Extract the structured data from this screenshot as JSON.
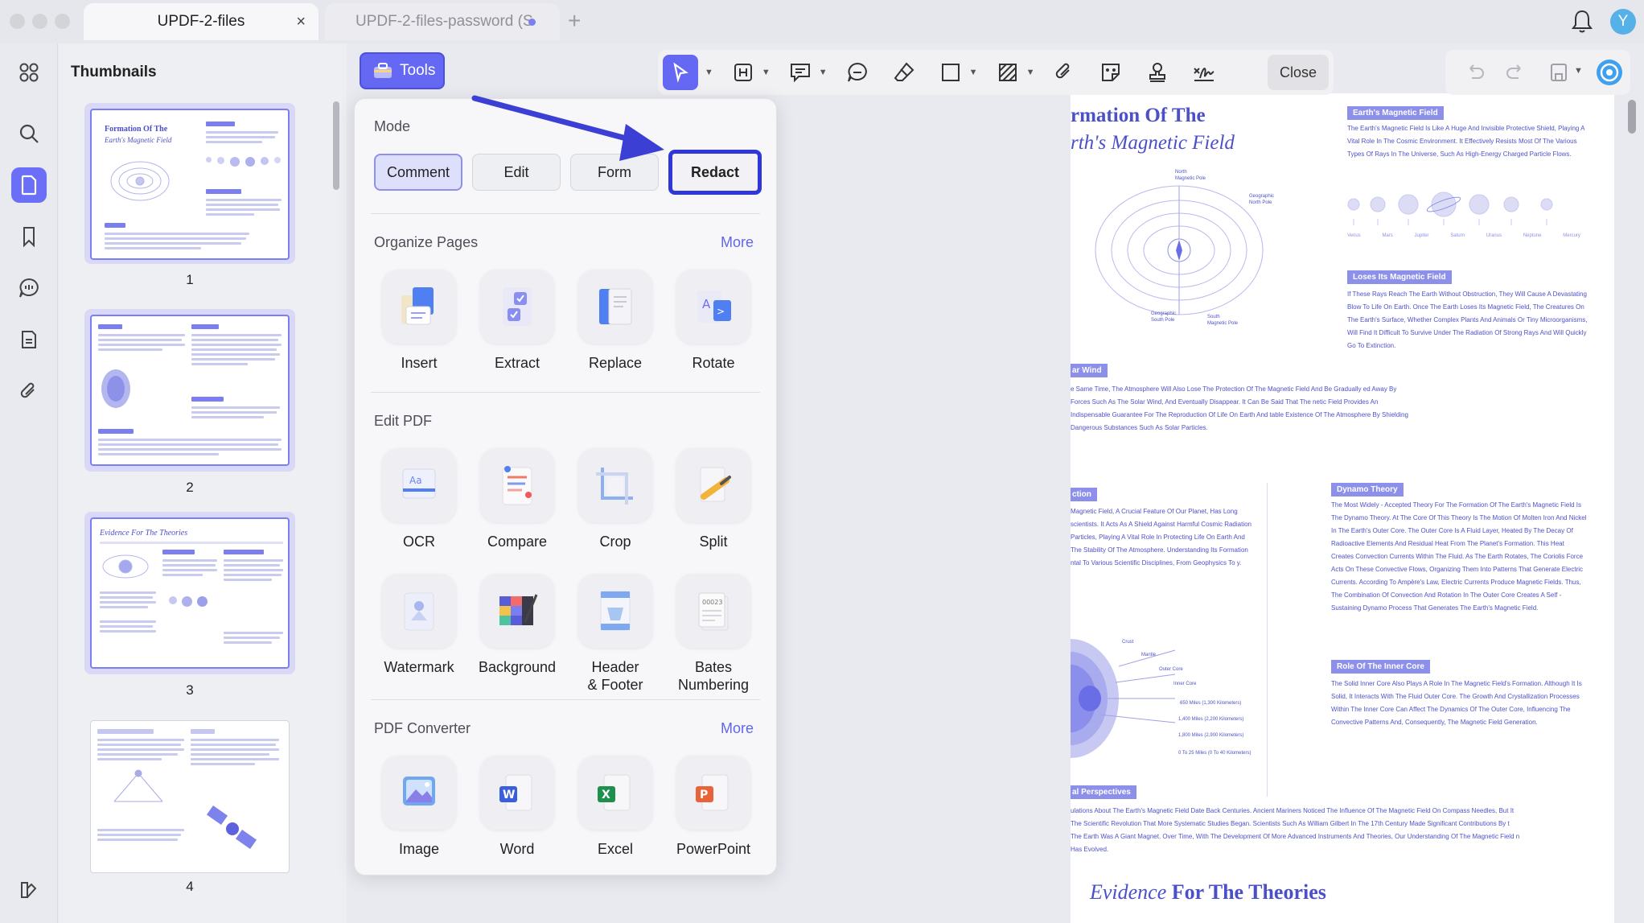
{
  "tabs": [
    {
      "title": "UPDF-2-files",
      "close": "×"
    },
    {
      "title": "UPDF-2-files-password (S"
    }
  ],
  "new_tab": "+",
  "avatar": "Y",
  "thumbnails": {
    "heading": "Thumbnails",
    "pages": [
      {
        "num": "1",
        "title": "Formation Of The",
        "title2": "Earth's Magnetic Field"
      },
      {
        "num": "2"
      },
      {
        "num": "3",
        "title": "Evidence For The Theories"
      },
      {
        "num": "4"
      }
    ]
  },
  "toolbar": {
    "tools_label": "Tools",
    "close_label": "Close"
  },
  "popup": {
    "mode": {
      "title": "Mode",
      "buttons": [
        "Comment",
        "Edit",
        "Form",
        "Redact"
      ],
      "selected": "Comment"
    },
    "organize": {
      "title": "Organize Pages",
      "more": "More",
      "items": [
        "Insert",
        "Extract",
        "Replace",
        "Rotate"
      ]
    },
    "edit_pdf": {
      "title": "Edit PDF",
      "items": [
        "OCR",
        "Compare",
        "Crop",
        "Split",
        "Watermark",
        "Background",
        "Header\n& Footer",
        "Bates\nNumbering"
      ]
    },
    "converter": {
      "title": "PDF Converter",
      "more": "More",
      "items": [
        "Image",
        "Word",
        "Excel",
        "PowerPoint"
      ]
    }
  },
  "document": {
    "page1": {
      "title_line1": "rmation Of The",
      "title_line2": "rth's Magnetic Field",
      "label1": "Earth's Magnetic Field",
      "para1": "The Earth's Magnetic Field Is Like A Huge And Invisible Protective Shield, Playing A Vital Role In The Cosmic Environment. It Effectively Resists Most Of The Various Types Of Rays In The Universe, Such As High-Energy Charged Particle Flows.",
      "planet_labels": [
        "Venus",
        "Mars",
        "Jupiter",
        "Saturn",
        "Uranus",
        "Neptune",
        "Mercury"
      ],
      "label2": "Loses Its Magnetic Field",
      "para2": "If These Rays Reach The Earth Without Obstruction, They Will Cause A Devastating Blow To Life On Earth. Once The Earth Loses Its Magnetic Field, The Creatures On The Earth's Surface, Whether Complex Plants And Animals Or Tiny Microorganisms, Will Find It Difficult To Survive Under The Radiation Of Strong Rays And Will Quickly Go To Extinction.",
      "label3": "ar Wind",
      "para3": "e Same Time, The Atmosphere Will Also Lose The Protection Of The Magnetic Field And Be Gradually ed Away By Forces Such As The Solar Wind, And Eventually Disappear. It Can Be Said That The netic Field Provides An Indispensable Guarantee For The Reproduction Of Life On Earth And table Existence Of The Atmosphere By Shielding Dangerous Substances Such As Solar Particles.",
      "diagram_labels": [
        "North Magnetic Pole",
        "Geographic North Pole",
        "Geographic South Pole",
        "South Magnetic Pole"
      ]
    },
    "page2": {
      "label_left": "ction",
      "para_left": "Magnetic Field, A Crucial Feature Of Our Planet, Has Long scientists. It Acts As A Shield Against Harmful Cosmic Radiation Particles, Playing A Vital Role In Protecting Life On Earth And The Stability Of The Atmosphere. Understanding Its Formation ntal To Various Scientific Disciplines, From Geophysics To y.",
      "label_dynamo": "Dynamo Theory",
      "para_dynamo": "The Most Widely - Accepted Theory For The Formation Of The Earth's Magnetic Field Is The Dynamo Theory. At The Core Of This Theory Is The Motion Of Molten Iron And Nickel In The Earth's Outer Core. The Outer Core Is A Fluid Layer, Heated By The Decay Of Radioactive Elements And Residual Heat From The Planet's Formation. This Heat Creates Convection Currents Within The Fluid. As The Earth Rotates, The Coriolis Force Acts On These Convective Flows, Organizing Them Into Patterns That Generate Electric Currents. According To Ampère's Law, Electric Currents Produce Magnetic Fields. Thus, The Combination Of Convection And Rotation In The Outer Core Creates A Self - Sustaining Dynamo Process That Generates The Earth's Magnetic Field.",
      "label_inner": "Role Of The Inner Core",
      "para_inner": "The Solid Inner Core Also Plays A Role In The Magnetic Field's Formation. Although It Is Solid, It Interacts With The Fluid Outer Core. The Growth And Crystallization Processes Within The Inner Core Can Affect The Dynamics Of The Outer Core, Influencing The Convective Patterns And, Consequently, The Magnetic Field Generation.",
      "layer_labels": [
        "Crust",
        "Mantle",
        "Outer Core",
        "Inner Core"
      ],
      "depth_labels": [
        "650 Miles (1,300 Kilometers)",
        "1,400 Miles (2,200 Kilometers)",
        "1,800 Miles (2,900 Kilometers)",
        "0 To 25 Miles (0 To 40 Kilometers)"
      ],
      "label_hist": "al Perspectives",
      "para_hist": "ulations About The Earth's Magnetic Field Date Back Centuries. Ancient Mariners Noticed The Influence Of The Magnetic Field On Compass Needles, But It The Scientific Revolution That More Systematic Studies Began. Scientists Such As William Gilbert In The 17th Century Made Significant Contributions By t The Earth Was A Giant Magnet. Over Time, With The Development Of More Advanced Instruments And Theories, Our Understanding Of The Magnetic Field n Has Evolved."
    },
    "page3": {
      "title_italic": "Evidence",
      "title_rest": "For The Theories"
    }
  },
  "colors": {
    "accent": "#6568F3",
    "redact_border": "#3037D8",
    "doc_text": "#4B4FC9",
    "annotation_arrow": "#3B3FD4"
  }
}
